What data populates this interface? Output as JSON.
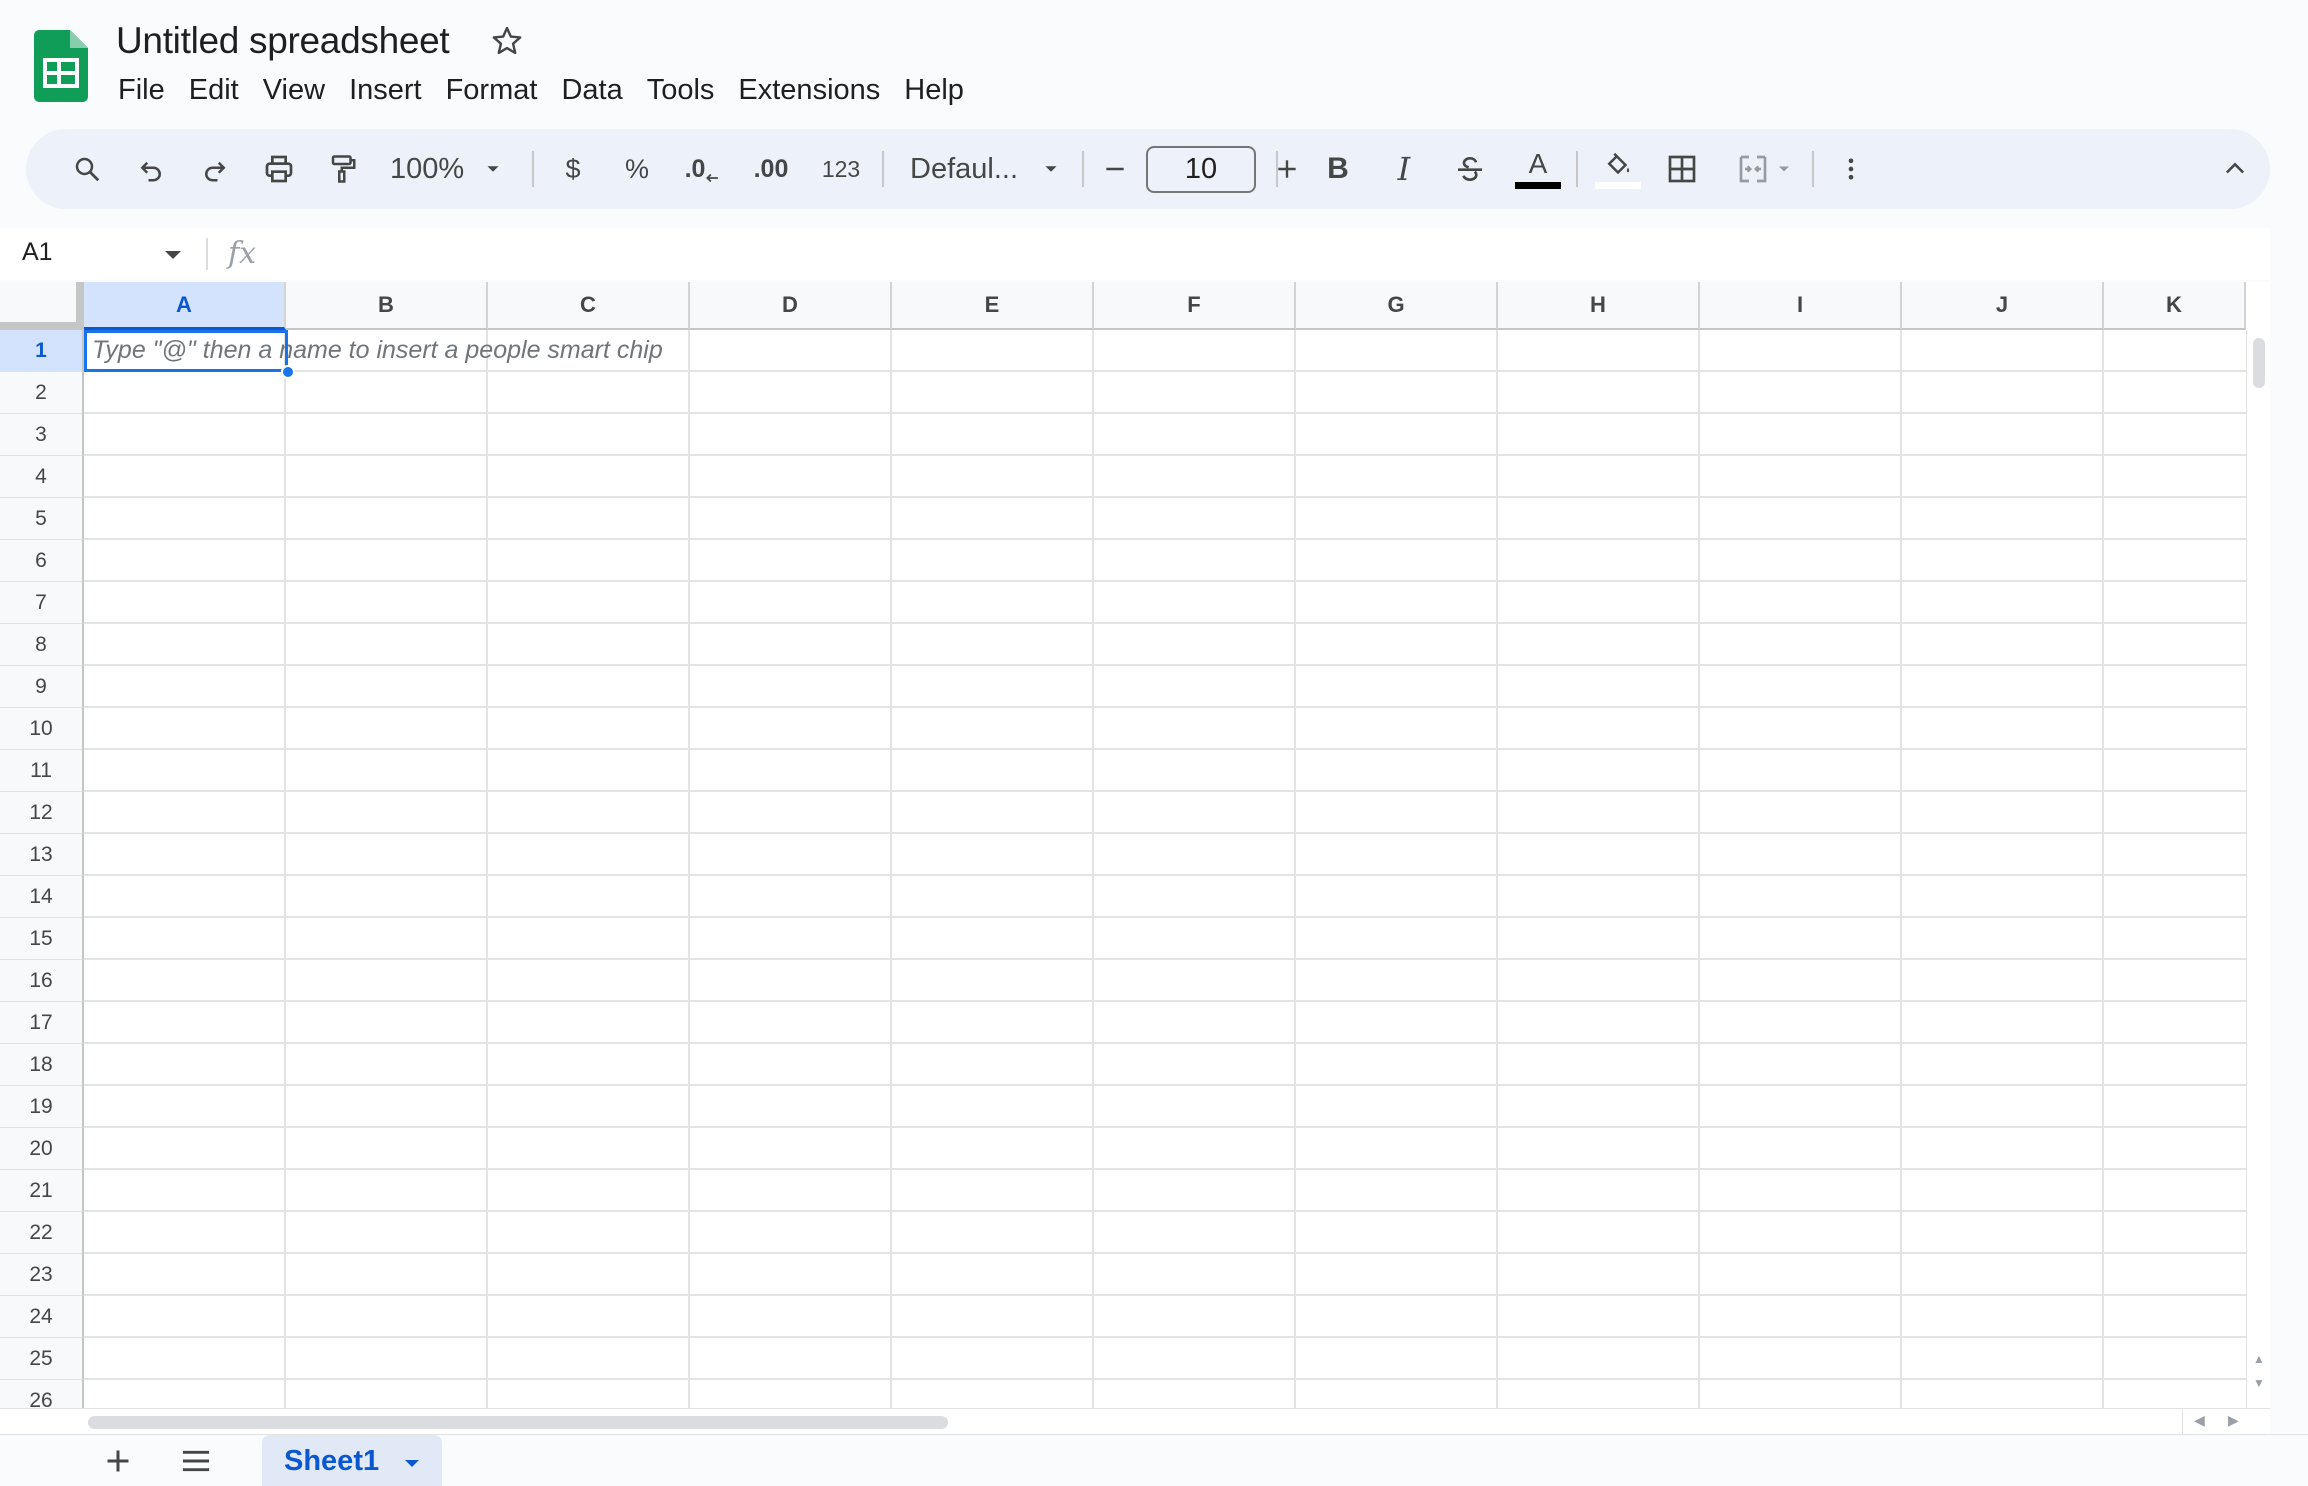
{
  "app": {
    "title": "Untitled spreadsheet",
    "brand_color": "#0f9d58"
  },
  "menu": [
    "File",
    "Edit",
    "View",
    "Insert",
    "Format",
    "Data",
    "Tools",
    "Extensions",
    "Help"
  ],
  "toolbar": {
    "zoom": "100%",
    "currency": "$",
    "percent": "%",
    "decrease_decimal": ".0",
    "increase_decimal": ".00",
    "number_format": "123",
    "font": "Defaul...",
    "font_size": "10",
    "bold": "B",
    "italic": "I",
    "text_color_label": "A",
    "accent_color": "#0b57d0"
  },
  "formula_bar": {
    "name_box": "A1",
    "fx": "fx",
    "value": ""
  },
  "grid": {
    "columns": [
      "A",
      "B",
      "C",
      "D",
      "E",
      "F",
      "G",
      "H",
      "I",
      "J",
      "K"
    ],
    "rows": [
      "1",
      "2",
      "3",
      "4",
      "5",
      "6",
      "7",
      "8",
      "9",
      "10",
      "11",
      "12",
      "13",
      "14",
      "15",
      "16",
      "17",
      "18",
      "19",
      "20",
      "21",
      "22",
      "23",
      "24",
      "25",
      "26"
    ],
    "selected_cell": "A1",
    "cell_hint": "Type \"@\" then a name to insert a people smart chip"
  },
  "sheets": {
    "tabs": [
      {
        "label": "Sheet1",
        "active": true
      }
    ]
  }
}
